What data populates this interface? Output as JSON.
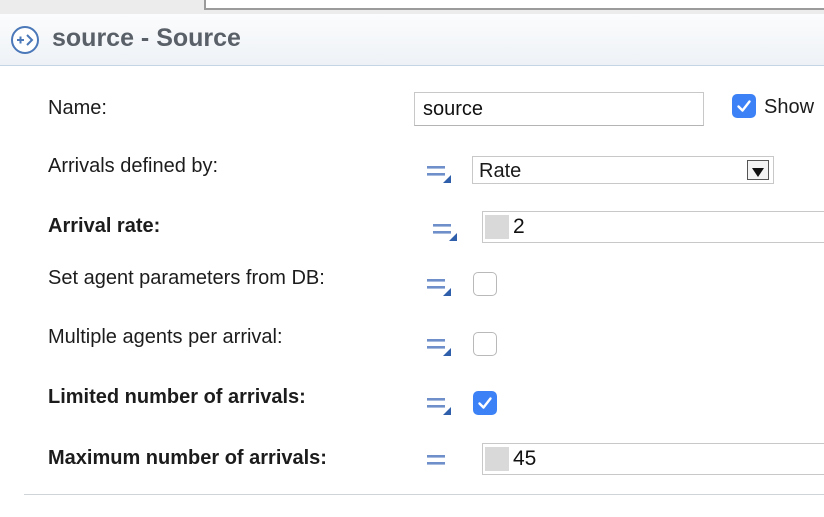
{
  "header": {
    "title": "source - Source",
    "icon": "source-plus-arrow-icon"
  },
  "fields": {
    "name": {
      "label": "Name:",
      "value": "source",
      "show_label": "Show",
      "show_checked": true
    },
    "arrivals_defined_by": {
      "label": "Arrivals defined by:",
      "value": "Rate"
    },
    "arrival_rate": {
      "label": "Arrival rate:",
      "value": "2"
    },
    "set_agent_params_db": {
      "label": "Set agent parameters from DB:",
      "checked": false
    },
    "multiple_agents": {
      "label": "Multiple agents per arrival:",
      "checked": false
    },
    "limited_arrivals": {
      "label": "Limited number of arrivals:",
      "checked": true
    },
    "max_arrivals": {
      "label": "Maximum number of arrivals:",
      "value": "45"
    }
  },
  "colors": {
    "accent": "#3c82f6",
    "title_text": "#5a6068",
    "header_border": "#c5d5e6"
  }
}
